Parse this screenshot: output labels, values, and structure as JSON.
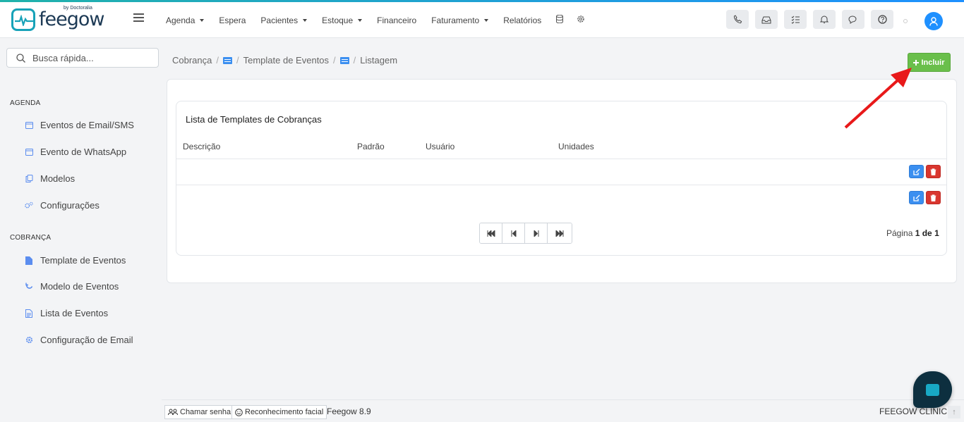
{
  "header": {
    "brand": "feegow",
    "brand_by": "by Doctoralia",
    "nav": [
      {
        "label": "Agenda",
        "dropdown": true
      },
      {
        "label": "Espera",
        "dropdown": false
      },
      {
        "label": "Pacientes",
        "dropdown": true
      },
      {
        "label": "Estoque",
        "dropdown": true
      },
      {
        "label": "Financeiro",
        "dropdown": false
      },
      {
        "label": "Faturamento",
        "dropdown": true
      },
      {
        "label": "Relatórios",
        "dropdown": false
      }
    ],
    "nav_icons": [
      "database-icon",
      "gear-icon"
    ],
    "right_icons": [
      "phone-icon",
      "inbox-icon",
      "tasks-icon",
      "bell-icon",
      "chat-icon",
      "help-icon"
    ]
  },
  "search": {
    "placeholder": "Busca rápida..."
  },
  "sidebar": {
    "sections": [
      {
        "title": "AGENDA",
        "items": [
          {
            "label": "Eventos de Email/SMS",
            "icon": "calendar-icon"
          },
          {
            "label": "Evento de WhatsApp",
            "icon": "calendar-icon"
          },
          {
            "label": "Modelos",
            "icon": "copy-icon"
          },
          {
            "label": "Configurações",
            "icon": "cogs-icon"
          }
        ]
      },
      {
        "title": "COBRANÇA",
        "items": [
          {
            "label": "Template de Eventos",
            "icon": "file-icon"
          },
          {
            "label": "Modelo de Eventos",
            "icon": "refresh-icon"
          },
          {
            "label": "Lista de Eventos",
            "icon": "file-text-icon"
          },
          {
            "label": "Configuração de Email",
            "icon": "gear-icon"
          }
        ]
      }
    ]
  },
  "breadcrumb": {
    "items": [
      "Cobrança",
      "Template de Eventos",
      "Listagem"
    ]
  },
  "actions": {
    "include_label": "Incluir"
  },
  "table": {
    "title": "Lista de Templates de Cobranças",
    "columns": [
      "Descrição",
      "Padrão",
      "Usuário",
      "Unidades"
    ],
    "rows": [
      {
        "descricao": "",
        "padrao": "",
        "usuario": "",
        "unidades": ""
      },
      {
        "descricao": "",
        "padrao": "",
        "usuario": "",
        "unidades": ""
      }
    ]
  },
  "pagination": {
    "prefix": "Página",
    "current": "1 de 1"
  },
  "footer": {
    "call_label": "Chamar senha",
    "face_label": "Reconhecimento facial",
    "version": "Feegow 8.9",
    "clinic": "FEEGOW CLINIC"
  },
  "colors": {
    "accent": "#1e90ff",
    "success": "#6abf4b",
    "danger": "#d9362f",
    "annotation": "#e8191a"
  }
}
